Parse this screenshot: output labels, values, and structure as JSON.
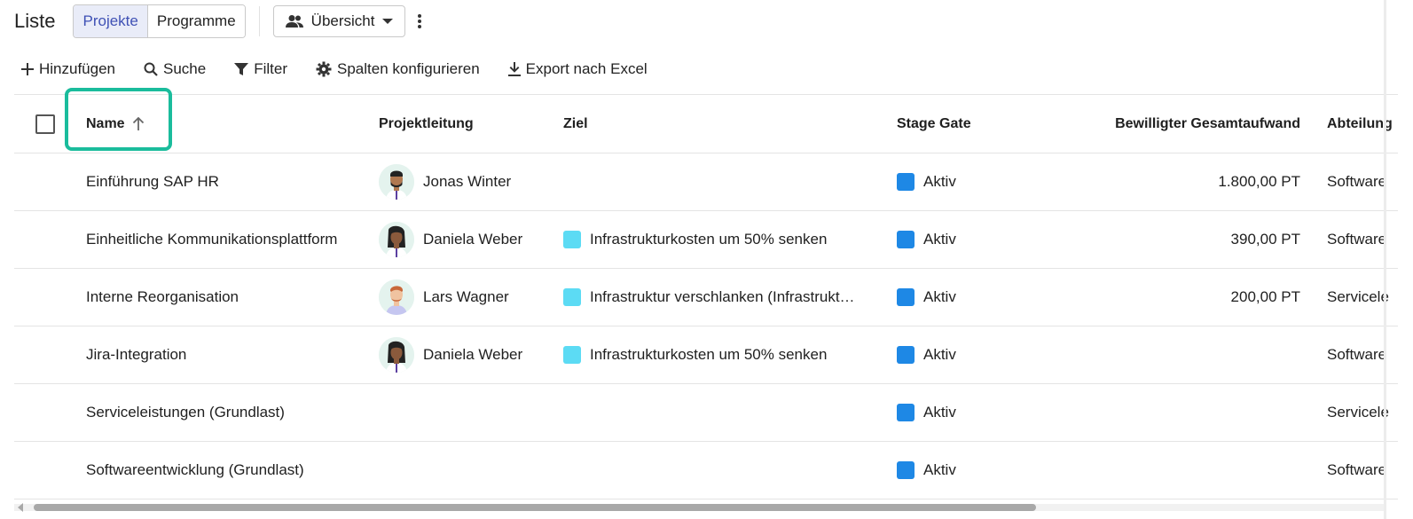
{
  "header": {
    "title": "Liste",
    "toggle": [
      "Projekte",
      "Programme"
    ],
    "view_label": "Übersicht"
  },
  "toolbar": {
    "add": "Hinzufügen",
    "search": "Suche",
    "filter": "Filter",
    "columns": "Spalten konfigurieren",
    "export": "Export nach Excel"
  },
  "columns": {
    "name": "Name",
    "lead": "Projektleitung",
    "goal": "Ziel",
    "stage": "Stage Gate",
    "effort": "Bewilligter Gesamtaufwand",
    "dept": "Abteilung"
  },
  "rows": [
    {
      "name": "Einführung SAP HR",
      "lead": "Jonas Winter",
      "lead_avatar": "man-beard",
      "goal": "",
      "stage": "Aktiv",
      "effort": "1.800,00 PT",
      "dept": "Software"
    },
    {
      "name": "Einheitliche Kommunikationsplattform",
      "lead": "Daniela Weber",
      "lead_avatar": "woman",
      "goal": "Infrastrukturkosten um 50% senken",
      "stage": "Aktiv",
      "effort": "390,00 PT",
      "dept": "Software"
    },
    {
      "name": "Interne Reorganisation",
      "lead": "Lars Wagner",
      "lead_avatar": "man-ginger",
      "goal": "Infrastruktur verschlanken (Infrastrukt…",
      "stage": "Aktiv",
      "effort": "200,00 PT",
      "dept": "Servicele"
    },
    {
      "name": "Jira-Integration",
      "lead": "Daniela Weber",
      "lead_avatar": "woman",
      "goal": "Infrastrukturkosten um 50% senken",
      "stage": "Aktiv",
      "effort": "",
      "dept": "Software"
    },
    {
      "name": "Serviceleistungen (Grundlast)",
      "lead": "",
      "lead_avatar": "",
      "goal": "",
      "stage": "Aktiv",
      "effort": "",
      "dept": "Servicele"
    },
    {
      "name": "Softwareentwicklung (Grundlast)",
      "lead": "",
      "lead_avatar": "",
      "goal": "",
      "stage": "Aktiv",
      "effort": "",
      "dept": "Software"
    }
  ],
  "colors": {
    "accent": "#3f51b5",
    "highlight": "#1abc9c",
    "stage_active": "#1e88e5",
    "goal": "#5cdbf4"
  },
  "icons": {
    "add": "plus-icon",
    "search": "search-icon",
    "filter": "filter-icon",
    "columns": "gear-icon",
    "export": "download-icon",
    "view": "people-icon",
    "menu": "more-vert-icon",
    "sort": "arrow-up-icon"
  }
}
